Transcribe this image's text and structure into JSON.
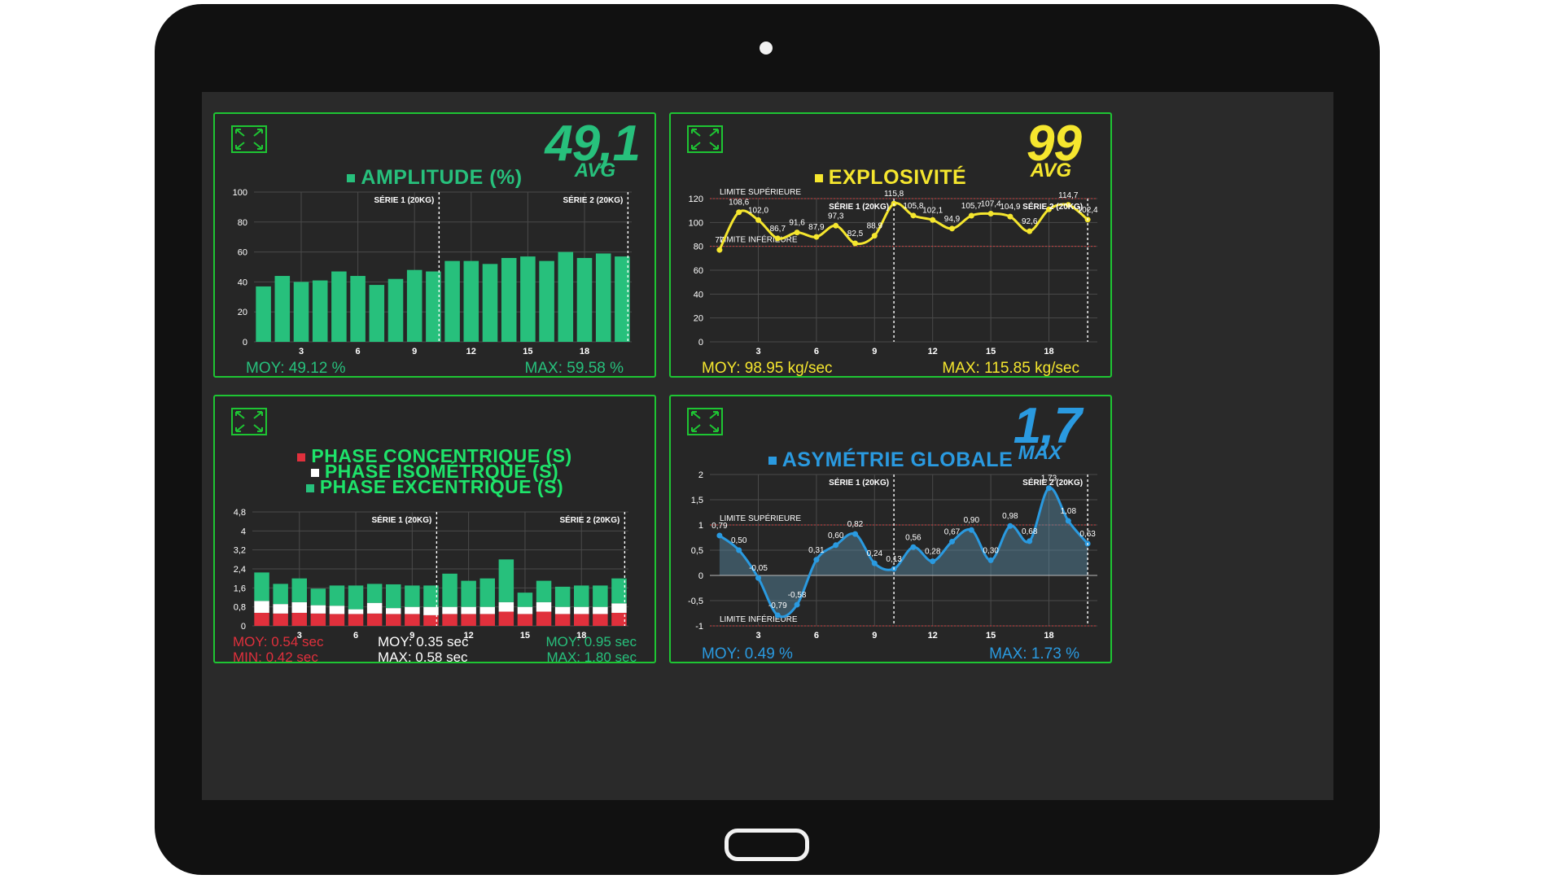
{
  "colors": {
    "panel_border": "#1ec533",
    "amplitude": "#27c07c",
    "explosivite": "#f5e62e",
    "asymetrie": "#2a9ae0",
    "concentrique": "#e0303c",
    "isometrique": "#ffffff",
    "excentrique": "#27c07c",
    "phase_title": "#1ee36a"
  },
  "icons": [
    "expand-icon"
  ],
  "amplitude": {
    "big_value": "49,1",
    "big_label": "AVG",
    "title": "AMPLITUDE (%)",
    "stat_moy": "MOY: 49.12 %",
    "stat_max": "MAX: 59.58 %",
    "chart_data": {
      "type": "bar",
      "title": "AMPLITUDE (%)",
      "x": [
        1,
        2,
        3,
        4,
        5,
        6,
        7,
        8,
        9,
        10,
        11,
        12,
        13,
        14,
        15,
        16,
        17,
        18,
        19,
        20
      ],
      "values": [
        37,
        44,
        40,
        41,
        47,
        44,
        38,
        42,
        48,
        47,
        54,
        54,
        52,
        56,
        57,
        54,
        60,
        56,
        59,
        57
      ],
      "ylim": [
        0,
        100
      ],
      "yticks": [
        0,
        20,
        40,
        60,
        80,
        100
      ],
      "xticks": [
        3,
        6,
        9,
        12,
        15,
        18
      ],
      "yticklabels": [
        "0",
        "20",
        "40",
        "60",
        "80",
        "100"
      ],
      "xticklabels": [
        "3",
        "6",
        "9",
        "12",
        "15",
        "18"
      ],
      "markers": [
        {
          "x": 10.3,
          "label": "SÉRIE 1 (20KG)"
        },
        {
          "x": 20.3,
          "label": "SÉRIE 2 (20KG)"
        }
      ],
      "grid": true
    }
  },
  "explosivite": {
    "big_value": "99",
    "big_label": "AVG",
    "title": "EXPLOSIVITÉ",
    "stat_moy": "MOY: 98.95 kg/sec",
    "stat_max": "MAX: 115.85 kg/sec",
    "chart_data": {
      "type": "line",
      "title": "EXPLOSIVITÉ",
      "x": [
        1,
        2,
        3,
        4,
        5,
        6,
        7,
        8,
        9,
        10,
        11,
        12,
        13,
        14,
        15,
        16,
        17,
        18,
        19,
        20
      ],
      "values": [
        77,
        108.6,
        102.0,
        86.7,
        91.6,
        87.9,
        97.3,
        82.5,
        88.9,
        115.8,
        105.8,
        102.1,
        94.9,
        105.7,
        107.4,
        104.9,
        92.6,
        111.0,
        114.7,
        102.4
      ],
      "data_labels": [
        "77",
        "108,6",
        "102,0",
        "86,7",
        "91,6",
        "87,9",
        "97,3",
        "82,5",
        "88,9",
        "115,8",
        "105,8",
        "102,1",
        "94,9",
        "105,7",
        "107,4",
        "104,9",
        "92,6",
        "",
        "114,7",
        "102,4"
      ],
      "ylim": [
        0,
        120
      ],
      "yticks": [
        0,
        20,
        40,
        60,
        80,
        100,
        120
      ],
      "xticks": [
        3,
        6,
        9,
        12,
        15,
        18
      ],
      "yticklabels": [
        "0",
        "20",
        "40",
        "60",
        "80",
        "100",
        "120"
      ],
      "xticklabels": [
        "3",
        "6",
        "9",
        "12",
        "15",
        "18"
      ],
      "limits": [
        {
          "y": 120,
          "label": "LIMITE SUPÉRIEURE"
        },
        {
          "y": 80,
          "label": "LIMITE INFÉRIEURE"
        }
      ],
      "markers": [
        {
          "x": 10.0,
          "label": "SÉRIE 1 (20KG)"
        },
        {
          "x": 20.0,
          "label": "SÉRIE 2 (20KG)"
        }
      ],
      "grid": true
    }
  },
  "phases": {
    "title_concentrique": "PHASE CONCENTRIQUE (S)",
    "title_isometrique": "PHASE ISOMÉTRQUE (S)",
    "title_excentrique": "PHASE EXCENTRIQUE (S)",
    "conc_moy": "MOY: 0.54 sec",
    "conc_min": "MIN: 0.42 sec",
    "iso_moy": "MOY: 0.35 sec",
    "iso_max": "MAX: 0.58 sec",
    "exc_moy": "MOY: 0.95 sec",
    "exc_max": "MAX: 1.80 sec",
    "chart_data": {
      "type": "bar",
      "stacked": true,
      "x": [
        1,
        2,
        3,
        4,
        5,
        6,
        7,
        8,
        9,
        10,
        11,
        12,
        13,
        14,
        15,
        16,
        17,
        18,
        19,
        20
      ],
      "series": [
        {
          "name": "PHASE CONCENTRIQUE (S)",
          "values": [
            0.55,
            0.52,
            0.55,
            0.52,
            0.5,
            0.5,
            0.52,
            0.5,
            0.5,
            0.45,
            0.5,
            0.5,
            0.5,
            0.6,
            0.5,
            0.6,
            0.5,
            0.5,
            0.5,
            0.55
          ]
        },
        {
          "name": "PHASE ISOMÉTRQUE (S)",
          "values": [
            0.5,
            0.4,
            0.45,
            0.35,
            0.35,
            0.2,
            0.45,
            0.25,
            0.3,
            0.35,
            0.3,
            0.3,
            0.3,
            0.4,
            0.3,
            0.4,
            0.3,
            0.3,
            0.3,
            0.4
          ]
        },
        {
          "name": "PHASE EXCENTRIQUE (S)",
          "values": [
            1.2,
            0.85,
            1.0,
            0.7,
            0.85,
            1.0,
            0.8,
            1.0,
            0.9,
            0.9,
            1.4,
            1.1,
            1.2,
            1.8,
            0.6,
            0.9,
            0.85,
            0.9,
            0.9,
            1.05
          ]
        }
      ],
      "ylim": [
        0,
        4.8
      ],
      "yticks": [
        0,
        0.8,
        1.6,
        2.4,
        3.2,
        4,
        4.8
      ],
      "yticklabels": [
        "0",
        "0,8",
        "1,6",
        "2,4",
        "3,2",
        "4",
        "4,8"
      ],
      "xticks": [
        3,
        6,
        9,
        12,
        15,
        18
      ],
      "xticklabels": [
        "3",
        "6",
        "9",
        "12",
        "15",
        "18"
      ],
      "markers": [
        {
          "x": 10.3,
          "label": "SÉRIE 1 (20KG)"
        },
        {
          "x": 20.3,
          "label": "SÉRIE 2 (20KG)"
        }
      ],
      "grid": true
    }
  },
  "asymetrie": {
    "big_value": "1,7",
    "big_label": "MAX",
    "title": "ASYMÉTRIE GLOBALE",
    "stat_moy": "MOY: 0.49 %",
    "stat_max": "MAX: 1.73 %",
    "chart_data": {
      "type": "area",
      "title": "ASYMÉTRIE GLOBALE",
      "x": [
        1,
        2,
        3,
        4,
        5,
        6,
        7,
        8,
        9,
        10,
        11,
        12,
        13,
        14,
        15,
        16,
        17,
        18,
        19,
        20
      ],
      "values": [
        0.79,
        0.5,
        -0.05,
        -0.79,
        -0.58,
        0.31,
        0.6,
        0.82,
        0.24,
        0.13,
        0.56,
        0.28,
        0.67,
        0.9,
        0.3,
        0.98,
        0.68,
        1.73,
        1.08,
        0.63
      ],
      "data_labels": [
        "0,79",
        "0,50",
        "-0,05",
        "-0,79",
        "-0,58",
        "0,31",
        "0,60",
        "0,82",
        "0,24",
        "0,13",
        "0,56",
        "0,28",
        "0,67",
        "0,90",
        "0,30",
        "0,98",
        "0,68",
        "1,73",
        "1,08",
        "0,63"
      ],
      "ylim": [
        -1,
        2
      ],
      "yticks": [
        -1,
        -0.5,
        0,
        0.5,
        1,
        1.5,
        2
      ],
      "yticklabels": [
        "-1",
        "-0,5",
        "0",
        "0,5",
        "1",
        "1,5",
        "2"
      ],
      "xticks": [
        3,
        6,
        9,
        12,
        15,
        18
      ],
      "xticklabels": [
        "3",
        "6",
        "9",
        "12",
        "15",
        "18"
      ],
      "limits": [
        {
          "y": 1,
          "label": "LIMITE SUPÉRIEURE"
        },
        {
          "y": -1,
          "label": "LIMITE INFÉRIEURE"
        }
      ],
      "markers": [
        {
          "x": 10.0,
          "label": "SÉRIE 1 (20KG)"
        },
        {
          "x": 20.0,
          "label": "SÉRIE 2 (20KG)"
        }
      ],
      "grid": true
    }
  }
}
